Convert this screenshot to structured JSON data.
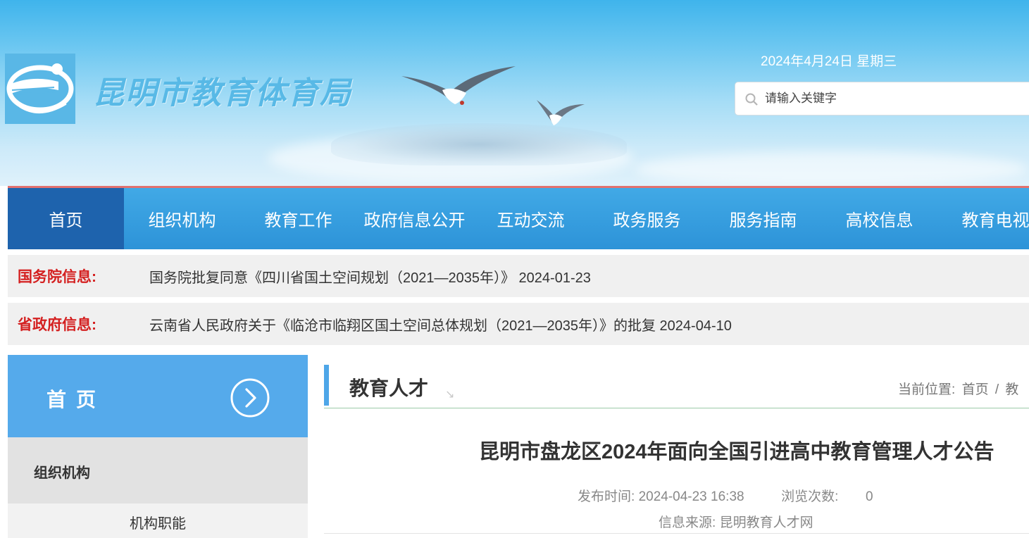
{
  "site": {
    "title": "昆明市教育体育局",
    "date": "2024年4月24日 星期三",
    "search_placeholder": "请输入关键字"
  },
  "nav": {
    "items": [
      {
        "label": "首页",
        "active": true
      },
      {
        "label": "组织机构"
      },
      {
        "label": "教育工作"
      },
      {
        "label": "政府信息公开"
      },
      {
        "label": "互动交流"
      },
      {
        "label": "政务服务"
      },
      {
        "label": "服务指南"
      },
      {
        "label": "高校信息"
      },
      {
        "label": "教育电视"
      }
    ]
  },
  "notices": [
    {
      "label": "国务院信息:",
      "text": "国务院批复同意《四川省国土空间规划（2021—2035年）》 2024-01-23"
    },
    {
      "label": "省政府信息:",
      "text": "云南省人民政府关于《临沧市临翔区国土空间总体规划（2021—2035年）》的批复 2024-04-10"
    }
  ],
  "sidebar": {
    "head_title": "首页",
    "section_label": "组织机构",
    "sub_item": "机构职能"
  },
  "main": {
    "section_title": "教育人才",
    "breadcrumb_prefix": "当前位置:",
    "breadcrumb_home": "首页",
    "breadcrumb_sep": "/",
    "breadcrumb_current": "教",
    "article_title": "昆明市盘龙区2024年面向全国引进高中教育管理人才公告",
    "publish_label": "发布时间:",
    "publish_time": "2024-04-23 16:38",
    "views_label": "浏览次数:",
    "views": "0",
    "source_label": "信息来源:",
    "source": "昆明教育人才网"
  },
  "colors": {
    "nav_bg": "#3aa2e3",
    "nav_active": "#1e63ad",
    "notice_label": "#d42020",
    "sidebar_head": "#55aaeb"
  }
}
